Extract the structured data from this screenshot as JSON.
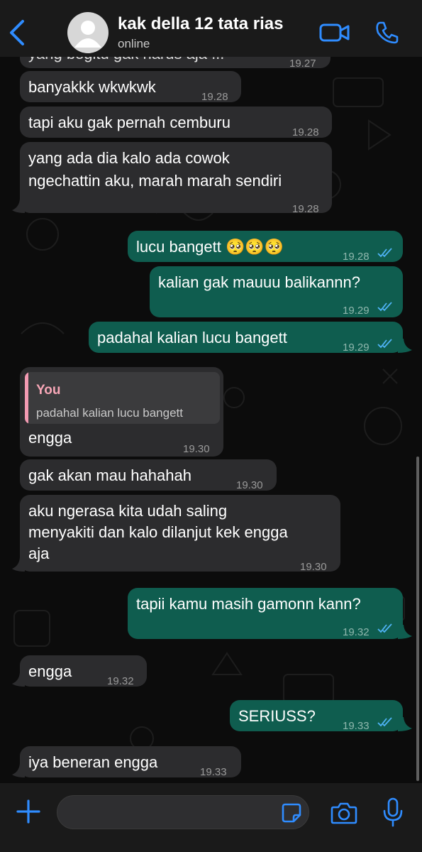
{
  "colors": {
    "accent": "#2f8cff",
    "incoming_bubble": "#2c2c2e",
    "outgoing_bubble": "#0f5d4f",
    "read_ticks": "#4fb3f6",
    "quote_author": "#f6a6b6"
  },
  "header": {
    "contact_name": "kak della 12 tata rias",
    "status": "online",
    "icons": [
      "chevron-left-icon",
      "avatar-icon",
      "video-call-icon",
      "phone-icon"
    ]
  },
  "messages": [
    {
      "dir": "in",
      "text": "yang begitu gak harus aja ... ",
      "time": "19.27"
    },
    {
      "dir": "in",
      "text": "banyakkk wkwkwk",
      "time": "19.28"
    },
    {
      "dir": "in",
      "text": "tapi aku gak pernah cemburu",
      "time": "19.28"
    },
    {
      "dir": "in",
      "line1": "yang ada dia kalo ada cowok",
      "line2": "ngechattin aku, marah marah sendiri",
      "time": "19.28"
    },
    {
      "dir": "out",
      "text": "lucu bangett 🥺🥺🥺",
      "time": "19.28",
      "status": "read"
    },
    {
      "dir": "out",
      "text": "kalian gak mauuu balikannn?",
      "time": "19.29",
      "status": "read"
    },
    {
      "dir": "out",
      "text": "padahal kalian lucu bangett",
      "time": "19.29",
      "status": "read"
    },
    {
      "dir": "in",
      "quote_author": "You",
      "quote_text": "padahal kalian lucu bangett",
      "text": "engga",
      "time": "19.30"
    },
    {
      "dir": "in",
      "text": "gak akan mau hahahah",
      "time": "19.30"
    },
    {
      "dir": "in",
      "line1": "aku ngerasa kita udah saling",
      "line2": "menyakiti dan kalo dilanjut kek engga",
      "line3": "aja",
      "time": "19.30"
    },
    {
      "dir": "out",
      "text": "tapii kamu masih gamonn kann?",
      "time": "19.32",
      "status": "read"
    },
    {
      "dir": "in",
      "text": "engga",
      "time": "19.32"
    },
    {
      "dir": "out",
      "text": "SERIUSS?",
      "time": "19.33",
      "status": "read"
    },
    {
      "dir": "in",
      "text": "iya beneran engga",
      "time": "19.33"
    }
  ],
  "input": {
    "placeholder": "",
    "icons": [
      "plus-icon",
      "sticker-icon",
      "camera-icon",
      "microphone-icon"
    ]
  }
}
